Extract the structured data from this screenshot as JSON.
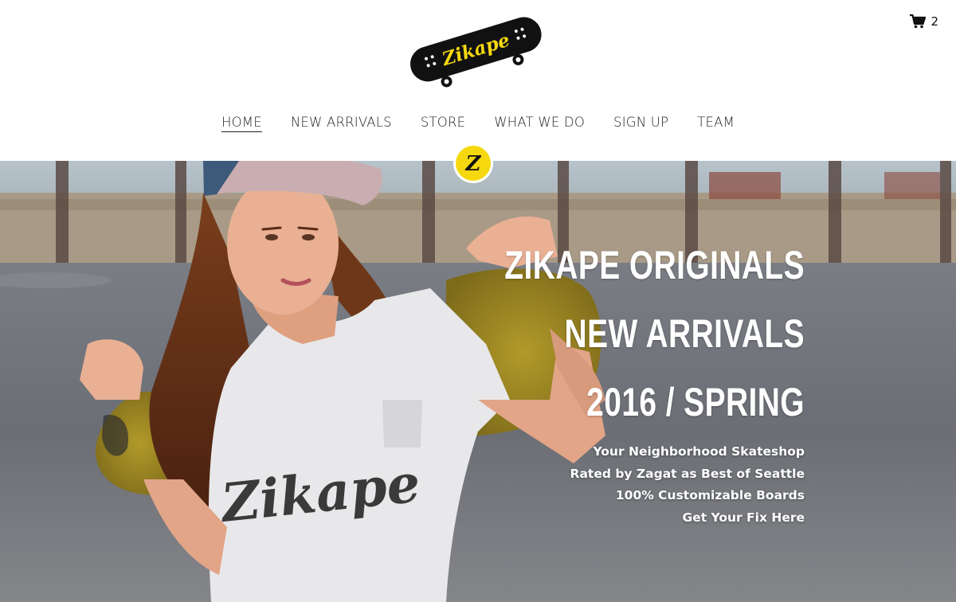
{
  "brand": {
    "logo_text": "Zikape",
    "badge_letter": "Z"
  },
  "cart": {
    "count": "2"
  },
  "nav": {
    "items": [
      {
        "label": "HOME",
        "active": true
      },
      {
        "label": "NEW ARRIVALS",
        "active": false
      },
      {
        "label": "STORE",
        "active": false
      },
      {
        "label": "WHAT WE DO",
        "active": false
      },
      {
        "label": "SIGN UP",
        "active": false
      },
      {
        "label": "TEAM",
        "active": false
      }
    ]
  },
  "hero": {
    "headline": [
      "ZIKAPE ORIGINALS",
      "NEW ARRIVALS",
      "2016 / SPRING"
    ],
    "tagline": [
      "Your Neighborhood Skateshop",
      "Rated by Zagat as Best of Seattle",
      "100% Customizable Boards",
      "Get Your Fix Here"
    ],
    "shirt_text": "Zikape"
  },
  "colors": {
    "accent_yellow": "#f5d90e",
    "nav_text": "#222222",
    "header_bg": "#ffffff"
  }
}
